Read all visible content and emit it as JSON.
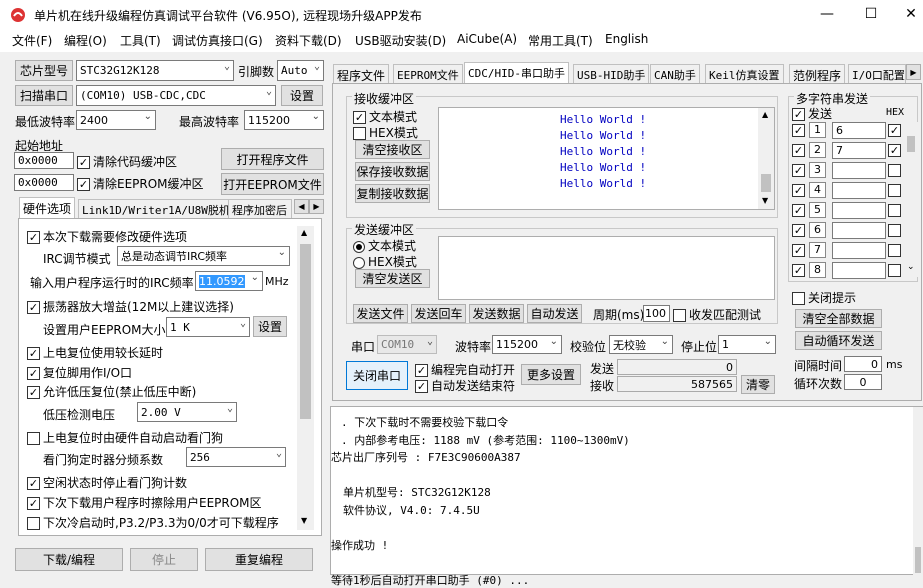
{
  "title": "单片机在线升级编程仿真调试平台软件 (V6.95O), 远程现场升级APP发布",
  "menu": [
    "文件(F)",
    "编程(O)",
    "工具(T)",
    "调试仿真接口(G)",
    "资料下载(D)",
    "USB驱动安装(D)",
    "AiCube(A)",
    "常用工具(T)",
    "English"
  ],
  "left": {
    "chip_btn": "芯片型号",
    "chip_value": "STC32G12K128",
    "pins_label": "引脚数",
    "pins_value": "Auto",
    "scan_btn": "扫描串口",
    "port_value": "(COM10) USB-CDC,CDC",
    "settings_btn": "设置",
    "min_baud_label": "最低波特率",
    "min_baud": "2400",
    "max_baud_label": "最高波特率",
    "max_baud": "115200",
    "start_addr_label": "起始地址",
    "addr1": "0x0000",
    "clear_code": "清除代码缓冲区",
    "open_prog": "打开程序文件",
    "addr2": "0x0000",
    "clear_eeprom": "清除EEPROM缓冲区",
    "open_eeprom": "打开EEPROM文件",
    "tabs": [
      "硬件选项",
      "Link1D/Writer1A/U8W脱机",
      "程序加密后"
    ],
    "hw": {
      "opt1": "本次下载需要修改硬件选项",
      "irc_mode_label": "IRC调节模式",
      "irc_mode": "总是动态调节IRC频率",
      "irc_freq_label": "输入用户程序运行时的IRC频率",
      "irc_freq": "11.0592",
      "mhz": "MHz",
      "opt2": "振荡器放大增益(12M以上建议选择)",
      "eeprom_size_label": "设置用户EEPROM大小",
      "eeprom_size": "1   K",
      "eeprom_set": "设置",
      "opt3": "上电复位使用较长延时",
      "opt4": "复位脚用作I/O口",
      "opt5": "允许低压复位(禁止低压中断)",
      "lv_label": "低压检测电压",
      "lv_value": "2.00 V",
      "opt6": "上电复位时由硬件自动启动看门狗",
      "wdt_label": "看门狗定时器分频系数",
      "wdt_value": "256",
      "opt7": "空闲状态时停止看门狗计数",
      "opt8": "下次下载用户程序时擦除用户EEPROM区",
      "opt9": "下次冷启动时,P3.2/P3.3为0/0才可下载程序"
    },
    "download_btn": "下载/编程",
    "stop_btn": "停止",
    "reprog_btn": "重复编程"
  },
  "right": {
    "tabs": [
      "程序文件",
      "EEPROM文件",
      "CDC/HID-串口助手",
      "USB-HID助手",
      "CAN助手",
      "Keil仿真设置",
      "范例程序",
      "I/O口配置"
    ],
    "recv": {
      "title": "接收缓冲区",
      "text_mode": "文本模式",
      "hex_mode": "HEX模式",
      "clear": "清空接收区",
      "save": "保存接收数据",
      "copy": "复制接收数据",
      "lines": [
        "Hello World !",
        "Hello World !",
        "Hello World !",
        "Hello World !",
        "Hello World !"
      ]
    },
    "send": {
      "title": "发送缓冲区",
      "text_mode": "文本模式",
      "hex_mode": "HEX模式",
      "clear": "清空发送区",
      "send_file": "发送文件",
      "send_enter": "发送回车",
      "send_data": "发送数据",
      "auto_send": "自动发送",
      "period_label": "周期(ms)",
      "period": "100",
      "match": "收发匹配测试"
    },
    "multi": {
      "title": "多字符串发送",
      "send_hdr": "发送",
      "hex_hdr": "HEX",
      "rows": [
        {
          "n": "1",
          "v": "6"
        },
        {
          "n": "2",
          "v": "7"
        },
        {
          "n": "3",
          "v": ""
        },
        {
          "n": "4",
          "v": ""
        },
        {
          "n": "5",
          "v": ""
        },
        {
          "n": "6",
          "v": ""
        },
        {
          "n": "7",
          "v": ""
        },
        {
          "n": "8",
          "v": ""
        }
      ],
      "close_tip": "关闭提示",
      "clear_all": "清空全部数据",
      "auto_loop": "自动循环发送",
      "interval_label": "间隔时间",
      "interval": "0",
      "ms": "ms",
      "loop_label": "循环次数",
      "loop": "0"
    },
    "serial": {
      "port_label": "串口",
      "port": "COM10",
      "baud_label": "波特率",
      "baud": "115200",
      "parity_label": "校验位",
      "parity": "无校验",
      "stop_label": "停止位",
      "stop": "1",
      "close_btn": "关闭串口",
      "auto_open": "编程完自动打开",
      "auto_close": "自动发送结束符",
      "more": "更多设置",
      "send_label": "发送",
      "send_count": "0",
      "recv_label": "接收",
      "recv_count": "587565",
      "clear_btn": "清零"
    }
  },
  "log": [
    ". 下次下载时不需要校验下载口令",
    ". 内部参考电压: 1188 mV (参考范围: 1100~1300mV)",
    "芯片出厂序列号 : F7E3C90600A387",
    "",
    "单片机型号: STC32G12K128",
    "软件协议, V4.0: 7.4.5U",
    "",
    "操作成功 !",
    "",
    "等待1秒后自动打开串口助手 (#0) ..."
  ]
}
